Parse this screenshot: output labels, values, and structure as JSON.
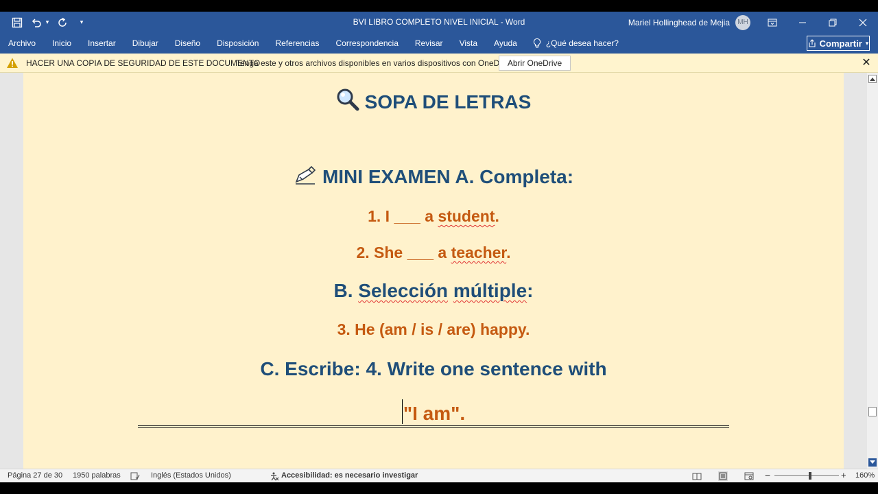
{
  "window": {
    "title": "BVI LIBRO COMPLETO NIVEL INICIAL  -  Word",
    "user_name": "Mariel Hollinghead de Mejia",
    "user_initials": "MH"
  },
  "ribbon": {
    "tabs": [
      "Archivo",
      "Inicio",
      "Insertar",
      "Dibujar",
      "Diseño",
      "Disposición",
      "Referencias",
      "Correspondencia",
      "Revisar",
      "Vista",
      "Ayuda"
    ],
    "tell_me": "¿Qué desea hacer?",
    "share_label": "Compartir"
  },
  "notice": {
    "title": "HACER UNA COPIA DE SEGURIDAD DE ESTE DOCUMENTO",
    "message": "Tenga este y otros archivos disponibles en varios dispositivos con OneDrive.",
    "button": "Abrir OneDrive"
  },
  "document": {
    "heading": "SOPA DE LETRAS",
    "exam_title": "MINI EXAMEN A. Completa:",
    "q1_prefix": "1.  I ___ a ",
    "q1_word": "student",
    "q1_suffix": ".",
    "q2_prefix": "2.  She ___ a ",
    "q2_word": "teacher",
    "q2_suffix": ".",
    "section_b_prefix": "B. ",
    "section_b_word1": "Selección",
    "section_b_word2": "múltiple",
    "section_b_suffix": ":",
    "q3": "3. He (am / is / are) happy.",
    "section_c": "C. Escribe: 4. Write one sentence with",
    "q4_tail": "\"I am\"."
  },
  "status": {
    "page": "Página 27 de 30",
    "words": "1950 palabras",
    "language": "Inglés (Estados Unidos)",
    "accessibility": "Accesibilidad: es necesario investigar",
    "zoom": "160%",
    "zoom_level": 160
  },
  "colors": {
    "accent": "#2b579a",
    "doc_blue": "#1f4e79",
    "doc_orange": "#c55a11",
    "page_bg": "#fff2cc",
    "notice_bg": "#fff4ce"
  }
}
